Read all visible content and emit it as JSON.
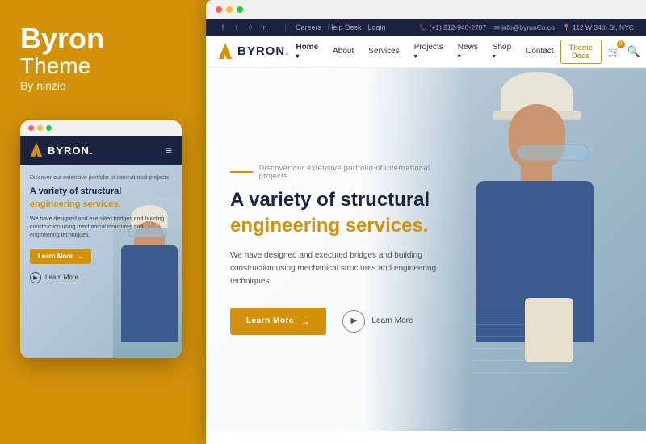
{
  "left": {
    "title": "Byron",
    "subtitle": "Theme",
    "author": "By ninzio"
  },
  "mobile": {
    "logo_text": "BYRON.",
    "hero_eyebrow": "Discover our extensive portfolio of international projects",
    "hero_title1": "A variety of structural",
    "hero_title2": "engineering services.",
    "hero_desc": "We have designed and executed bridges and building construction using mechanical structures and engineering techniques.",
    "btn_primary": "Learn More",
    "btn_secondary": "Learn More"
  },
  "desktop": {
    "topbar": {
      "careers": "Careers",
      "helpdesk": "Help Desk",
      "login": "Login",
      "phone": "(+1) 212-946-2707",
      "email": "info@byronCo.co",
      "location": "112 W 34th St, NYC"
    },
    "navbar": {
      "logo_text": "BYRON.",
      "logo_dot": ".",
      "theme_docs": "Theme Docs",
      "links": [
        "Home",
        "About",
        "Services",
        "Projects",
        "News",
        "Shop",
        "Contact"
      ],
      "cart_count": "0"
    },
    "hero": {
      "eyebrow": "Discover our extensive portfolio of international projects",
      "title1": "A variety of structural",
      "title2": "engineering services.",
      "desc": "We have designed and executed bridges and building construction using mechanical structures and engineering techniques.",
      "btn_primary": "Learn More",
      "btn_secondary": "Learn More"
    }
  },
  "colors": {
    "orange": "#D4920A",
    "dark_navy": "#1a2340",
    "white": "#ffffff"
  }
}
